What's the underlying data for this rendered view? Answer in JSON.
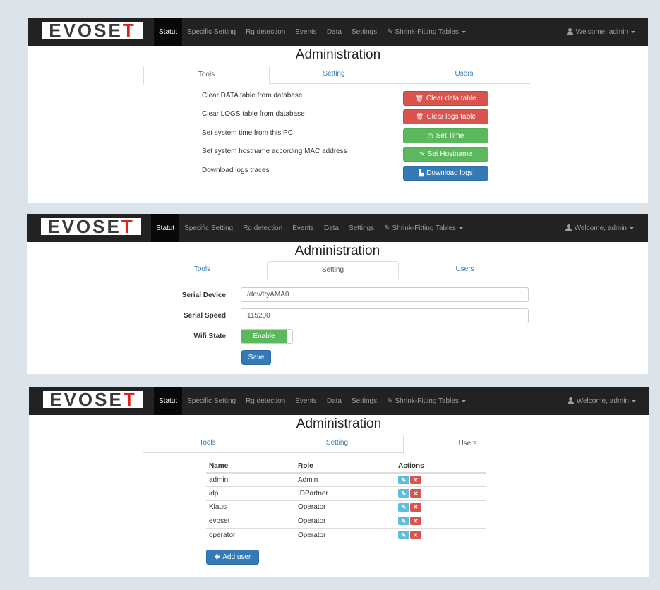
{
  "nav": {
    "brand_main": "EVOSE",
    "brand_last": "T",
    "items": [
      "Statut",
      "Specific Setting",
      "Rg detection",
      "Events",
      "Data",
      "Settings"
    ],
    "dropdown": "Shrink-Fitting Tables",
    "user": "Welcome, admin"
  },
  "page_title": "Administration",
  "tabs": [
    "Tools",
    "Setting",
    "Users"
  ],
  "tools": {
    "rows": [
      {
        "label": "Clear DATA table from database",
        "button": "Clear data table",
        "icon": "trash-icon",
        "style": "danger"
      },
      {
        "label": "Clear LOGS table from database",
        "button": "Clear logs table",
        "icon": "trash-icon",
        "style": "danger"
      },
      {
        "label": "Set system time from this PC",
        "button": "Set Time",
        "icon": "clock-icon",
        "style": "success"
      },
      {
        "label": "Set system hostname according MAC address",
        "button": "Set Hostname",
        "icon": "pencil-icon",
        "style": "success"
      },
      {
        "label": "Download logs traces",
        "button": "Download logs",
        "icon": "file-icon",
        "style": "primary"
      }
    ]
  },
  "setting": {
    "serial_device_label": "Serial Device",
    "serial_device_value": "/dev/ttyAMA0",
    "serial_speed_label": "Serial Speed",
    "serial_speed_value": "115200",
    "wifi_label": "Wifi State",
    "wifi_value": "Enable",
    "save": "Save"
  },
  "users": {
    "columns": [
      "Name",
      "Role",
      "Actions"
    ],
    "rows": [
      {
        "name": "admin",
        "role": "Admin"
      },
      {
        "name": "idp",
        "role": "IDPartner"
      },
      {
        "name": "Klaus",
        "role": "Operator"
      },
      {
        "name": "evoset",
        "role": "Operator"
      },
      {
        "name": "operator",
        "role": "Operator"
      }
    ],
    "add_user": "Add user"
  },
  "colors": {
    "navbar": "#222222",
    "danger": "#d9534f",
    "success": "#5cb85c",
    "primary": "#337ab7",
    "info": "#5bc0de",
    "brand_accent": "#e32119"
  }
}
